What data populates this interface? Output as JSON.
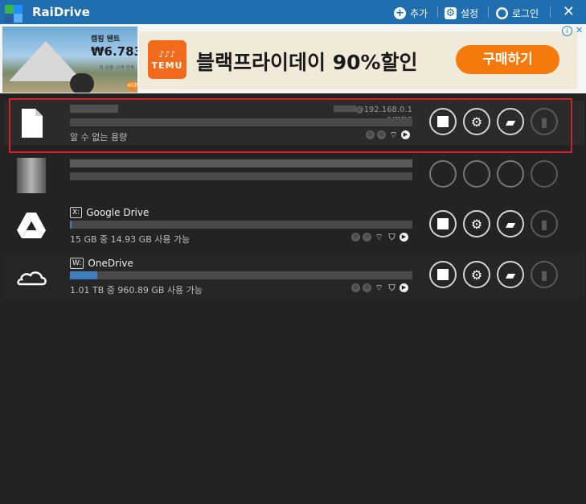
{
  "app": {
    "title": "RaiDrive"
  },
  "toolbar": {
    "add_label": "추가",
    "settings_label": "설정",
    "login_label": "로그인",
    "close_label": "✕"
  },
  "ad": {
    "photo_label": "캠핑 텐트",
    "photo_price": "₩6.783",
    "photo_sub": "최 상품 고객 만족",
    "photo_badge": "40초",
    "brand_line1": "♪♪♪",
    "brand_name": "TEMU",
    "headline": "블랙프라이데이 90%할인",
    "cta": "구매하기",
    "info_icon": "i",
    "close_icon": "✕"
  },
  "drives": [
    {
      "label": "",
      "letter": "",
      "url": "@192.168.0.1",
      "path": "/HDD2",
      "info": "알 수 없는 용량",
      "usage_fraction": 0,
      "icon": "file-icon"
    },
    {
      "label": "",
      "letter": "",
      "url": "",
      "path": "",
      "info": "",
      "usage_fraction": 0,
      "icon": "blurred-icon"
    },
    {
      "label": "Google Drive",
      "letter": "X:",
      "url": "",
      "path": "",
      "info": "15 GB 중 14.93 GB 사용 가능",
      "usage_fraction": 0.005,
      "icon": "google-drive-icon"
    },
    {
      "label": "OneDrive",
      "letter": "W:",
      "url": "",
      "path": "",
      "info": "1.01 TB 중 960.89 GB 사용 가능",
      "usage_fraction": 0.08,
      "icon": "onedrive-icon"
    }
  ],
  "colors": {
    "titlebar": "#1f6fb0",
    "accent": "#3f7fc0",
    "highlight": "#d3222a",
    "cta": "#f57a0b"
  }
}
